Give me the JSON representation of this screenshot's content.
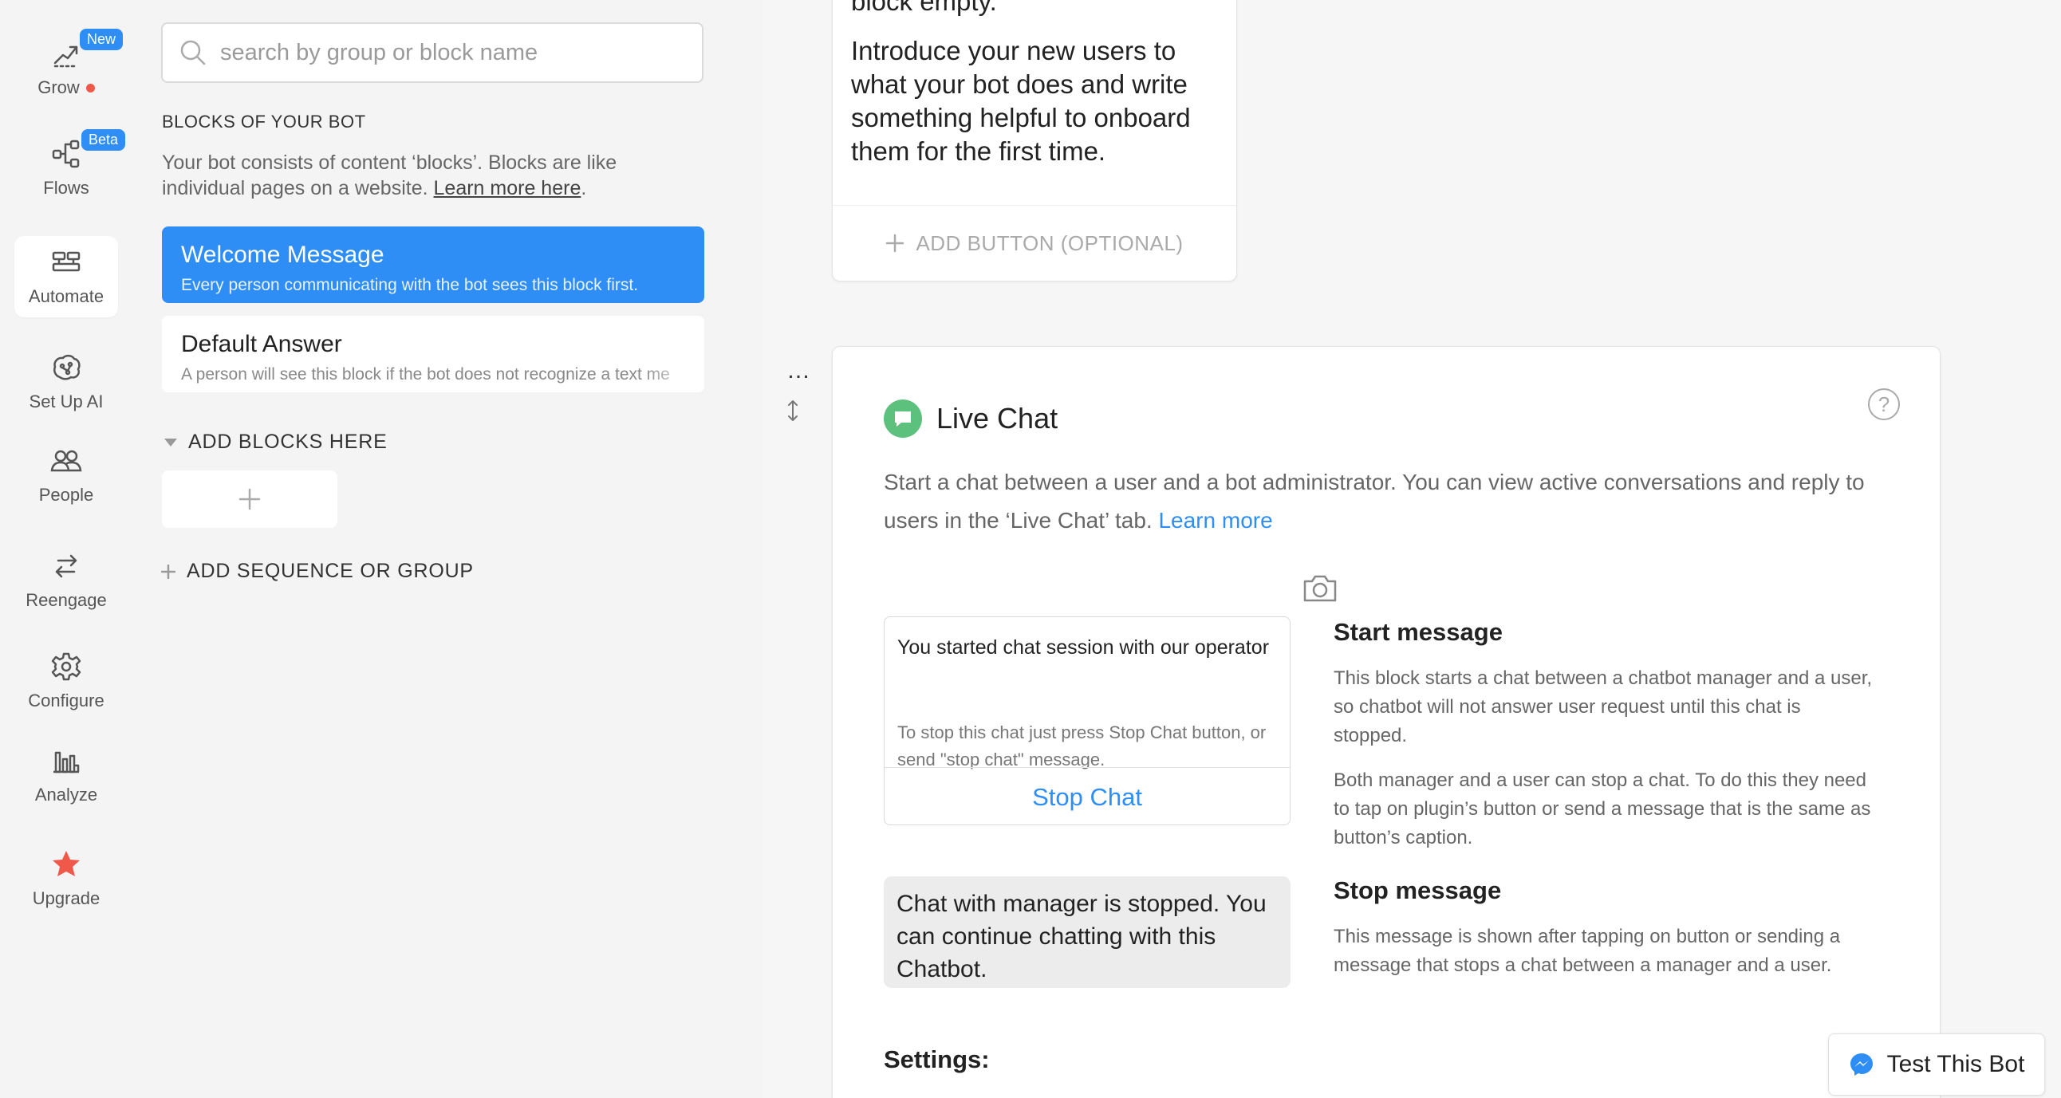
{
  "nav": {
    "items": [
      {
        "id": "grow",
        "label": "Grow",
        "badge": "New",
        "icon": "grow-trend-icon",
        "has_dot": true
      },
      {
        "id": "flows",
        "label": "Flows",
        "badge": "Beta",
        "icon": "flows-icon"
      },
      {
        "id": "automate",
        "label": "Automate",
        "icon": "automate-blocks-icon",
        "active": true
      },
      {
        "id": "setup-ai",
        "label": "Set Up AI",
        "icon": "ai-brain-icon"
      },
      {
        "id": "people",
        "label": "People",
        "icon": "people-icon"
      },
      {
        "id": "reengage",
        "label": "Reengage",
        "icon": "reengage-arrows-icon"
      },
      {
        "id": "configure",
        "label": "Configure",
        "icon": "gear-icon"
      },
      {
        "id": "analyze",
        "label": "Analyze",
        "icon": "bar-chart-icon"
      },
      {
        "id": "upgrade",
        "label": "Upgrade",
        "icon": "star-icon"
      }
    ]
  },
  "panel": {
    "search_placeholder": "search by group or block name",
    "section_title": "BLOCKS OF YOUR BOT",
    "section_desc": "Your bot consists of content ‘blocks’. Blocks are like individual pages on a website.",
    "learn_more": "Learn more here",
    "period": ".",
    "blocks": [
      {
        "title": "Welcome Message",
        "subtitle": "Every person communicating with the bot sees this block first."
      },
      {
        "title": "Default Answer",
        "subtitle": "A person will see this block if the bot does not recognize a text me"
      }
    ],
    "add_blocks_label": "ADD BLOCKS HERE",
    "add_sequence_label": "ADD SEQUENCE OR GROUP"
  },
  "main": {
    "top_card": {
      "partial_text": "block empty.",
      "intro": "Introduce your new users to what your bot does and write something helpful to onboard them for the first time.",
      "add_button": "ADD BUTTON (OPTIONAL)"
    },
    "more_dots": "…",
    "live_chat": {
      "title": "Live Chat",
      "desc": "Start a chat between a user and a bot administrator. You can view active conversations and reply to users in the ‘Live Chat’ tab.",
      "learn_more": "Learn more",
      "chat_message": "You started chat session with our operator",
      "chat_hint": "To stop this chat just press Stop Chat button, or send \"stop chat\" message.",
      "stop_button": "Stop Chat",
      "stop_bubble": "Chat with manager is stopped. You can continue chatting with this Chatbot.",
      "start_heading": "Start message",
      "start_p1": "This block starts a chat between a chatbot manager and a user, so chatbot will not answer user request until this chat is stopped.",
      "start_p2": "Both manager and a user can stop a chat. To do this they need to tap on plugin’s button or send a message that is the same as button’s caption.",
      "stop_heading": "Stop message",
      "stop_p": "This message is shown after tapping on button or sending a message that stops a chat between a manager and a user.",
      "settings_label": "Settings:"
    },
    "test_bot": "Test This Bot"
  },
  "colors": {
    "accent": "#2e8ef5",
    "live_chat_green": "#5cc17c",
    "upgrade_star": "#f0584a"
  }
}
